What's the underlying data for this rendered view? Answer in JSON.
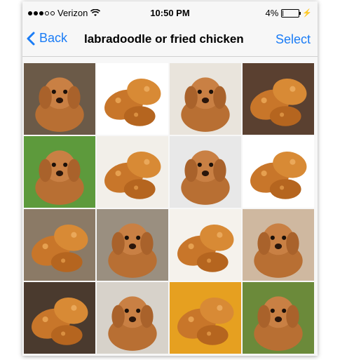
{
  "status_bar": {
    "carrier": "Verizon",
    "time": "10:50 PM",
    "battery_percent": "4%",
    "battery_level": 0.04,
    "icons": [
      "signal-dots-icon",
      "wifi-icon",
      "battery-icon",
      "charging-bolt-icon"
    ]
  },
  "nav": {
    "back_label": "Back",
    "title": "labradoodle or fried chicken",
    "select_label": "Select"
  },
  "grid": {
    "tiles": [
      {
        "subject": "labradoodle"
      },
      {
        "subject": "fried-chicken"
      },
      {
        "subject": "labradoodle"
      },
      {
        "subject": "fried-chicken"
      },
      {
        "subject": "labradoodle"
      },
      {
        "subject": "fried-chicken"
      },
      {
        "subject": "labradoodle"
      },
      {
        "subject": "fried-chicken"
      },
      {
        "subject": "fried-chicken"
      },
      {
        "subject": "labradoodle"
      },
      {
        "subject": "fried-chicken"
      },
      {
        "subject": "labradoodle"
      },
      {
        "subject": "fried-chicken"
      },
      {
        "subject": "labradoodle"
      },
      {
        "subject": "fried-chicken"
      },
      {
        "subject": "labradoodle"
      }
    ]
  },
  "colors": {
    "accent": "#1a7cf6",
    "dog_fur": "#c07a3c",
    "chicken_crust": "#c8762a"
  }
}
